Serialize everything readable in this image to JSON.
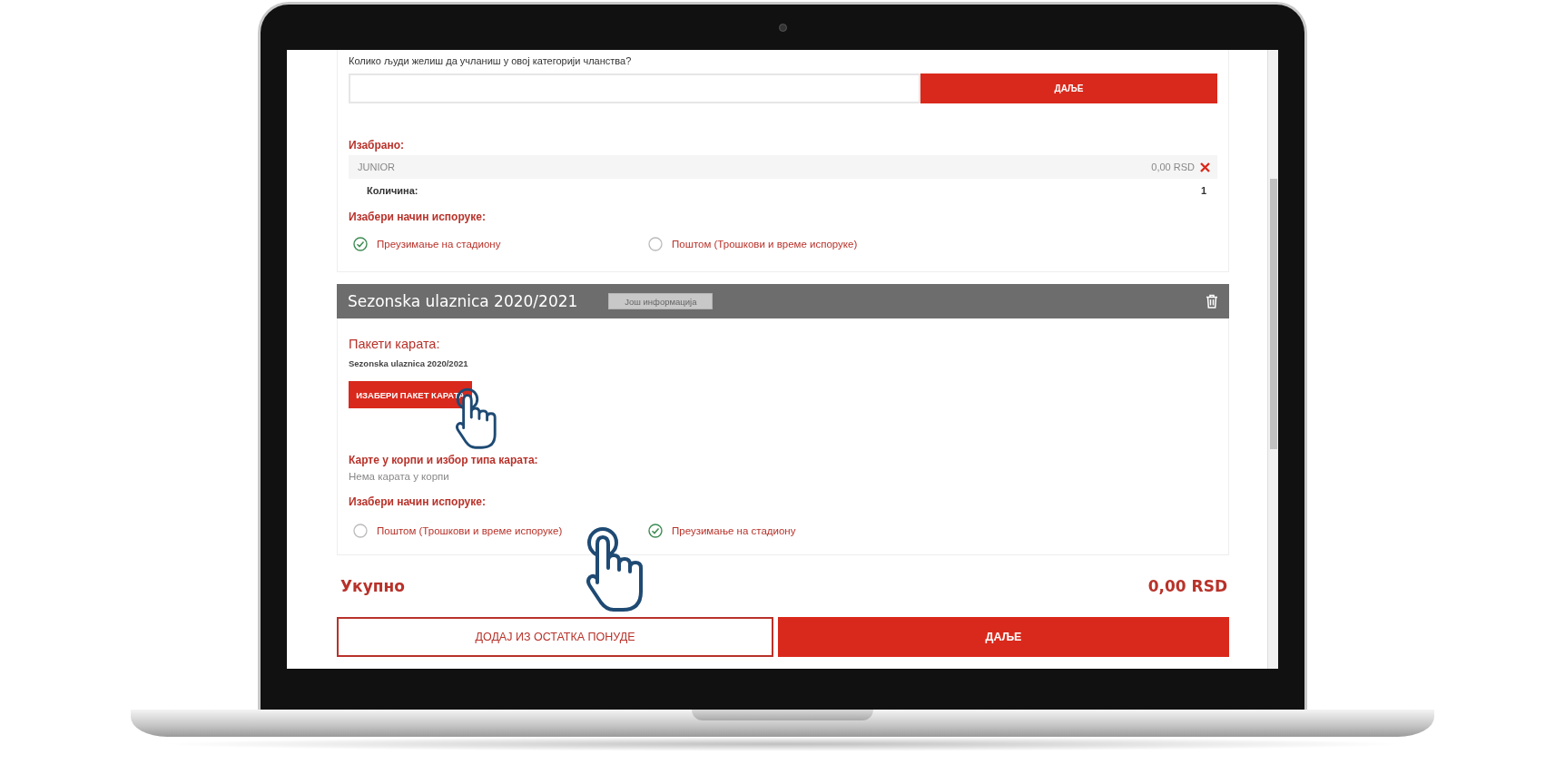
{
  "membership": {
    "question": "Колико људи желиш да учланиш у овој категорији чланства?",
    "next_button": "ДАЉЕ",
    "selected_heading": "Изабрано:",
    "items": [
      {
        "name": "JUNIOR",
        "price": "0,00 RSD"
      }
    ],
    "quantity_label": "Количина:",
    "quantity_value": "1",
    "delivery_heading": "Изабери начин испоруке:",
    "delivery_options": [
      {
        "label": "Преузимање на стадиону",
        "selected": true
      },
      {
        "label": "Поштом (Трошкови и време испоруке)",
        "selected": false
      }
    ]
  },
  "season_ticket": {
    "title": "Sezonska ulaznica 2020/2021",
    "info_button": "Још информација",
    "packages_heading": "Пакети карата:",
    "package_name": "Sezonska ulaznica 2020/2021",
    "choose_button": "ИЗАБЕРИ ПАКЕТ КАРАТА",
    "cart_heading": "Карте у корпи и избор типа карата:",
    "cart_empty": "Нема карата у корпи",
    "delivery_heading": "Изабери начин испоруке:",
    "delivery_options": [
      {
        "label": "Поштом (Трошкови и време испоруке)",
        "selected": false
      },
      {
        "label": "Преузимање на стадиону",
        "selected": true
      }
    ]
  },
  "total": {
    "label": "Укупно",
    "value": "0,00 RSD"
  },
  "buttons": [
    {
      "label": "ДОДАЈ ИЗ ОСТАТКА ПОНУДЕ",
      "kind": "outline"
    },
    {
      "label": "ДАЉЕ",
      "kind": "primary"
    }
  ]
}
